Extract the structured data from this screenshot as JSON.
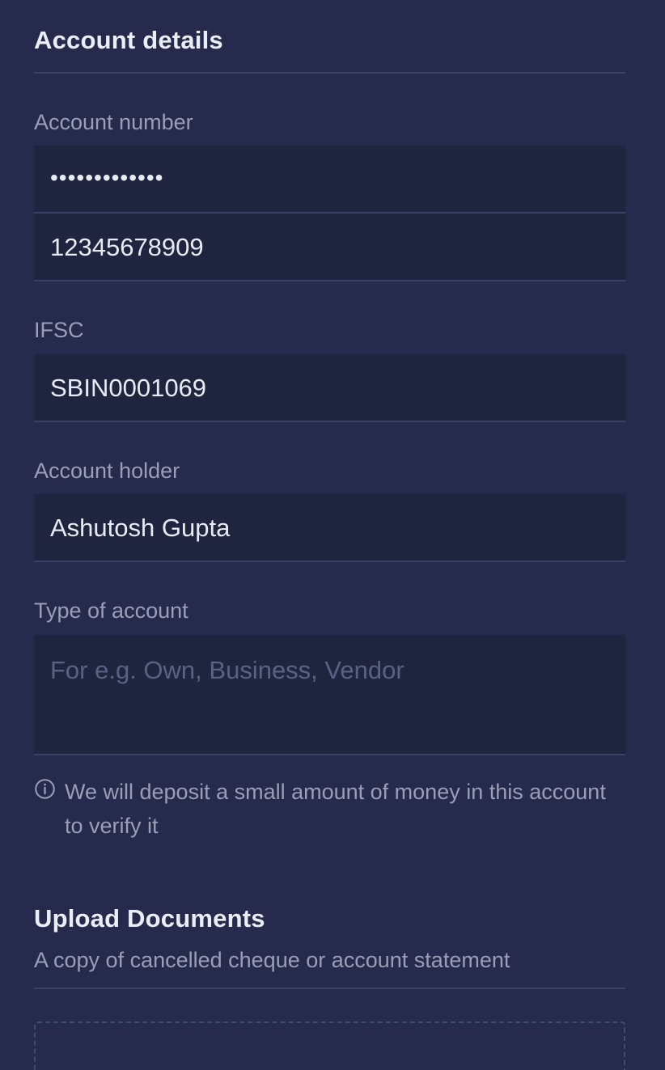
{
  "account_details": {
    "title": "Account details",
    "account_number": {
      "label": "Account number",
      "masked_value": "•••••••••••••",
      "confirm_value": "12345678909"
    },
    "ifsc": {
      "label": "IFSC",
      "value": "SBIN0001069"
    },
    "account_holder": {
      "label": "Account holder",
      "value": "Ashutosh Gupta"
    },
    "type_of_account": {
      "label": "Type of account",
      "placeholder": "For e.g. Own, Business, Vendor",
      "value": ""
    },
    "info_note": "We will deposit a small amount of money in this account to verify it"
  },
  "upload_documents": {
    "title": "Upload Documents",
    "subtitle": "A copy of cancelled cheque or account statement"
  },
  "icons": {
    "info": "info-circle-icon"
  },
  "colors": {
    "background": "#262b4d",
    "field_background": "#20253f",
    "divider": "#3a4066",
    "label": "#9a9fb7",
    "placeholder": "#5b6183"
  }
}
